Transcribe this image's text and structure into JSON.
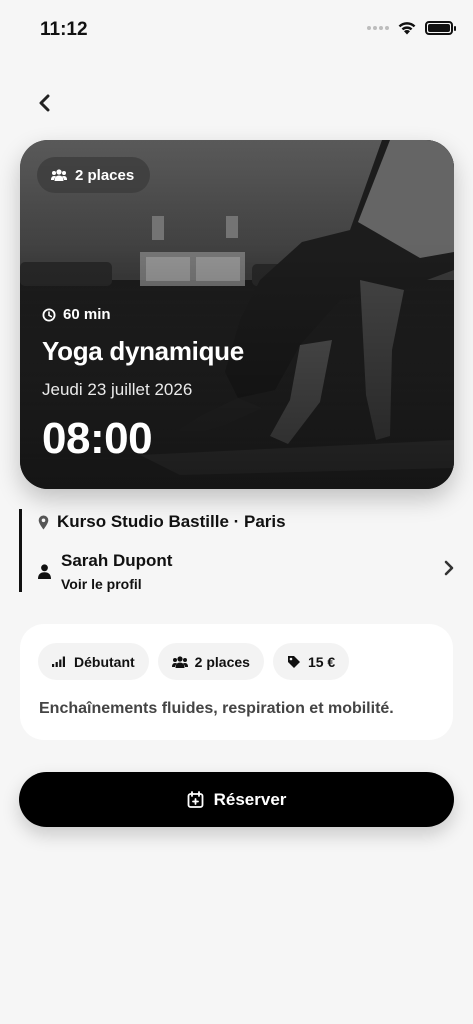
{
  "status_bar": {
    "time": "11:12"
  },
  "header": {
    "back_icon": "chevron-left-icon"
  },
  "hero": {
    "places": "2 places",
    "duration": "60 min",
    "title": "Yoga dynamique",
    "date": "Jeudi 23 juillet 2026",
    "time": "08:00"
  },
  "info": {
    "location": "Kurso Studio Bastille · Paris",
    "coach_name": "Sarah Dupont",
    "coach_link": "Voir le profil"
  },
  "details": {
    "tags": [
      {
        "icon": "signal-bars-icon",
        "label": "Débutant"
      },
      {
        "icon": "users-icon",
        "label": "2 places"
      },
      {
        "icon": "price-tag-icon",
        "label": "15 €"
      }
    ],
    "description": "Enchaînements fluides, respiration et mobilité."
  },
  "actions": {
    "reserve_label": "Réserver"
  }
}
